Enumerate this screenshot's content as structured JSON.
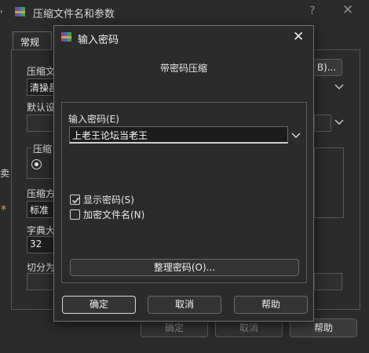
{
  "background": {
    "edge_text": ",",
    "title": "压缩文件名和参数",
    "help_glyph": "?",
    "close_glyph": "✕",
    "tab_label": "常规",
    "archive_name_label": "压缩文",
    "archive_name_value": "清操昌",
    "browse_label": "B)...",
    "profile_label": "默认设",
    "format_label": "压缩",
    "method_label": "压缩方",
    "method_value": "标准",
    "dict_label": "字典大",
    "dict_value": "32",
    "split_label": "切分为",
    "side_char": "卖",
    "ok_label": "确定",
    "cancel_label": "取消",
    "help_label": "帮助"
  },
  "dialog": {
    "title": "输入密码",
    "close_glyph": "✕",
    "subtitle": "带密码压缩",
    "password_label": "输入密码(E)",
    "password_value": "上老王论坛当老王",
    "show_password_label": "显示密码(S)",
    "show_password_checked": true,
    "encrypt_names_label": "加密文件名(N)",
    "encrypt_names_checked": false,
    "organize_label": "整理密码(O)...",
    "ok_label": "确定",
    "cancel_label": "取消",
    "help_label": "帮助"
  },
  "icons": {
    "app": "winrar-books-icon",
    "chevron": "chevron-down-icon"
  },
  "colors": {
    "background": "#2b2b2b",
    "text": "#e6e6e6",
    "border": "#6a6a6a"
  }
}
